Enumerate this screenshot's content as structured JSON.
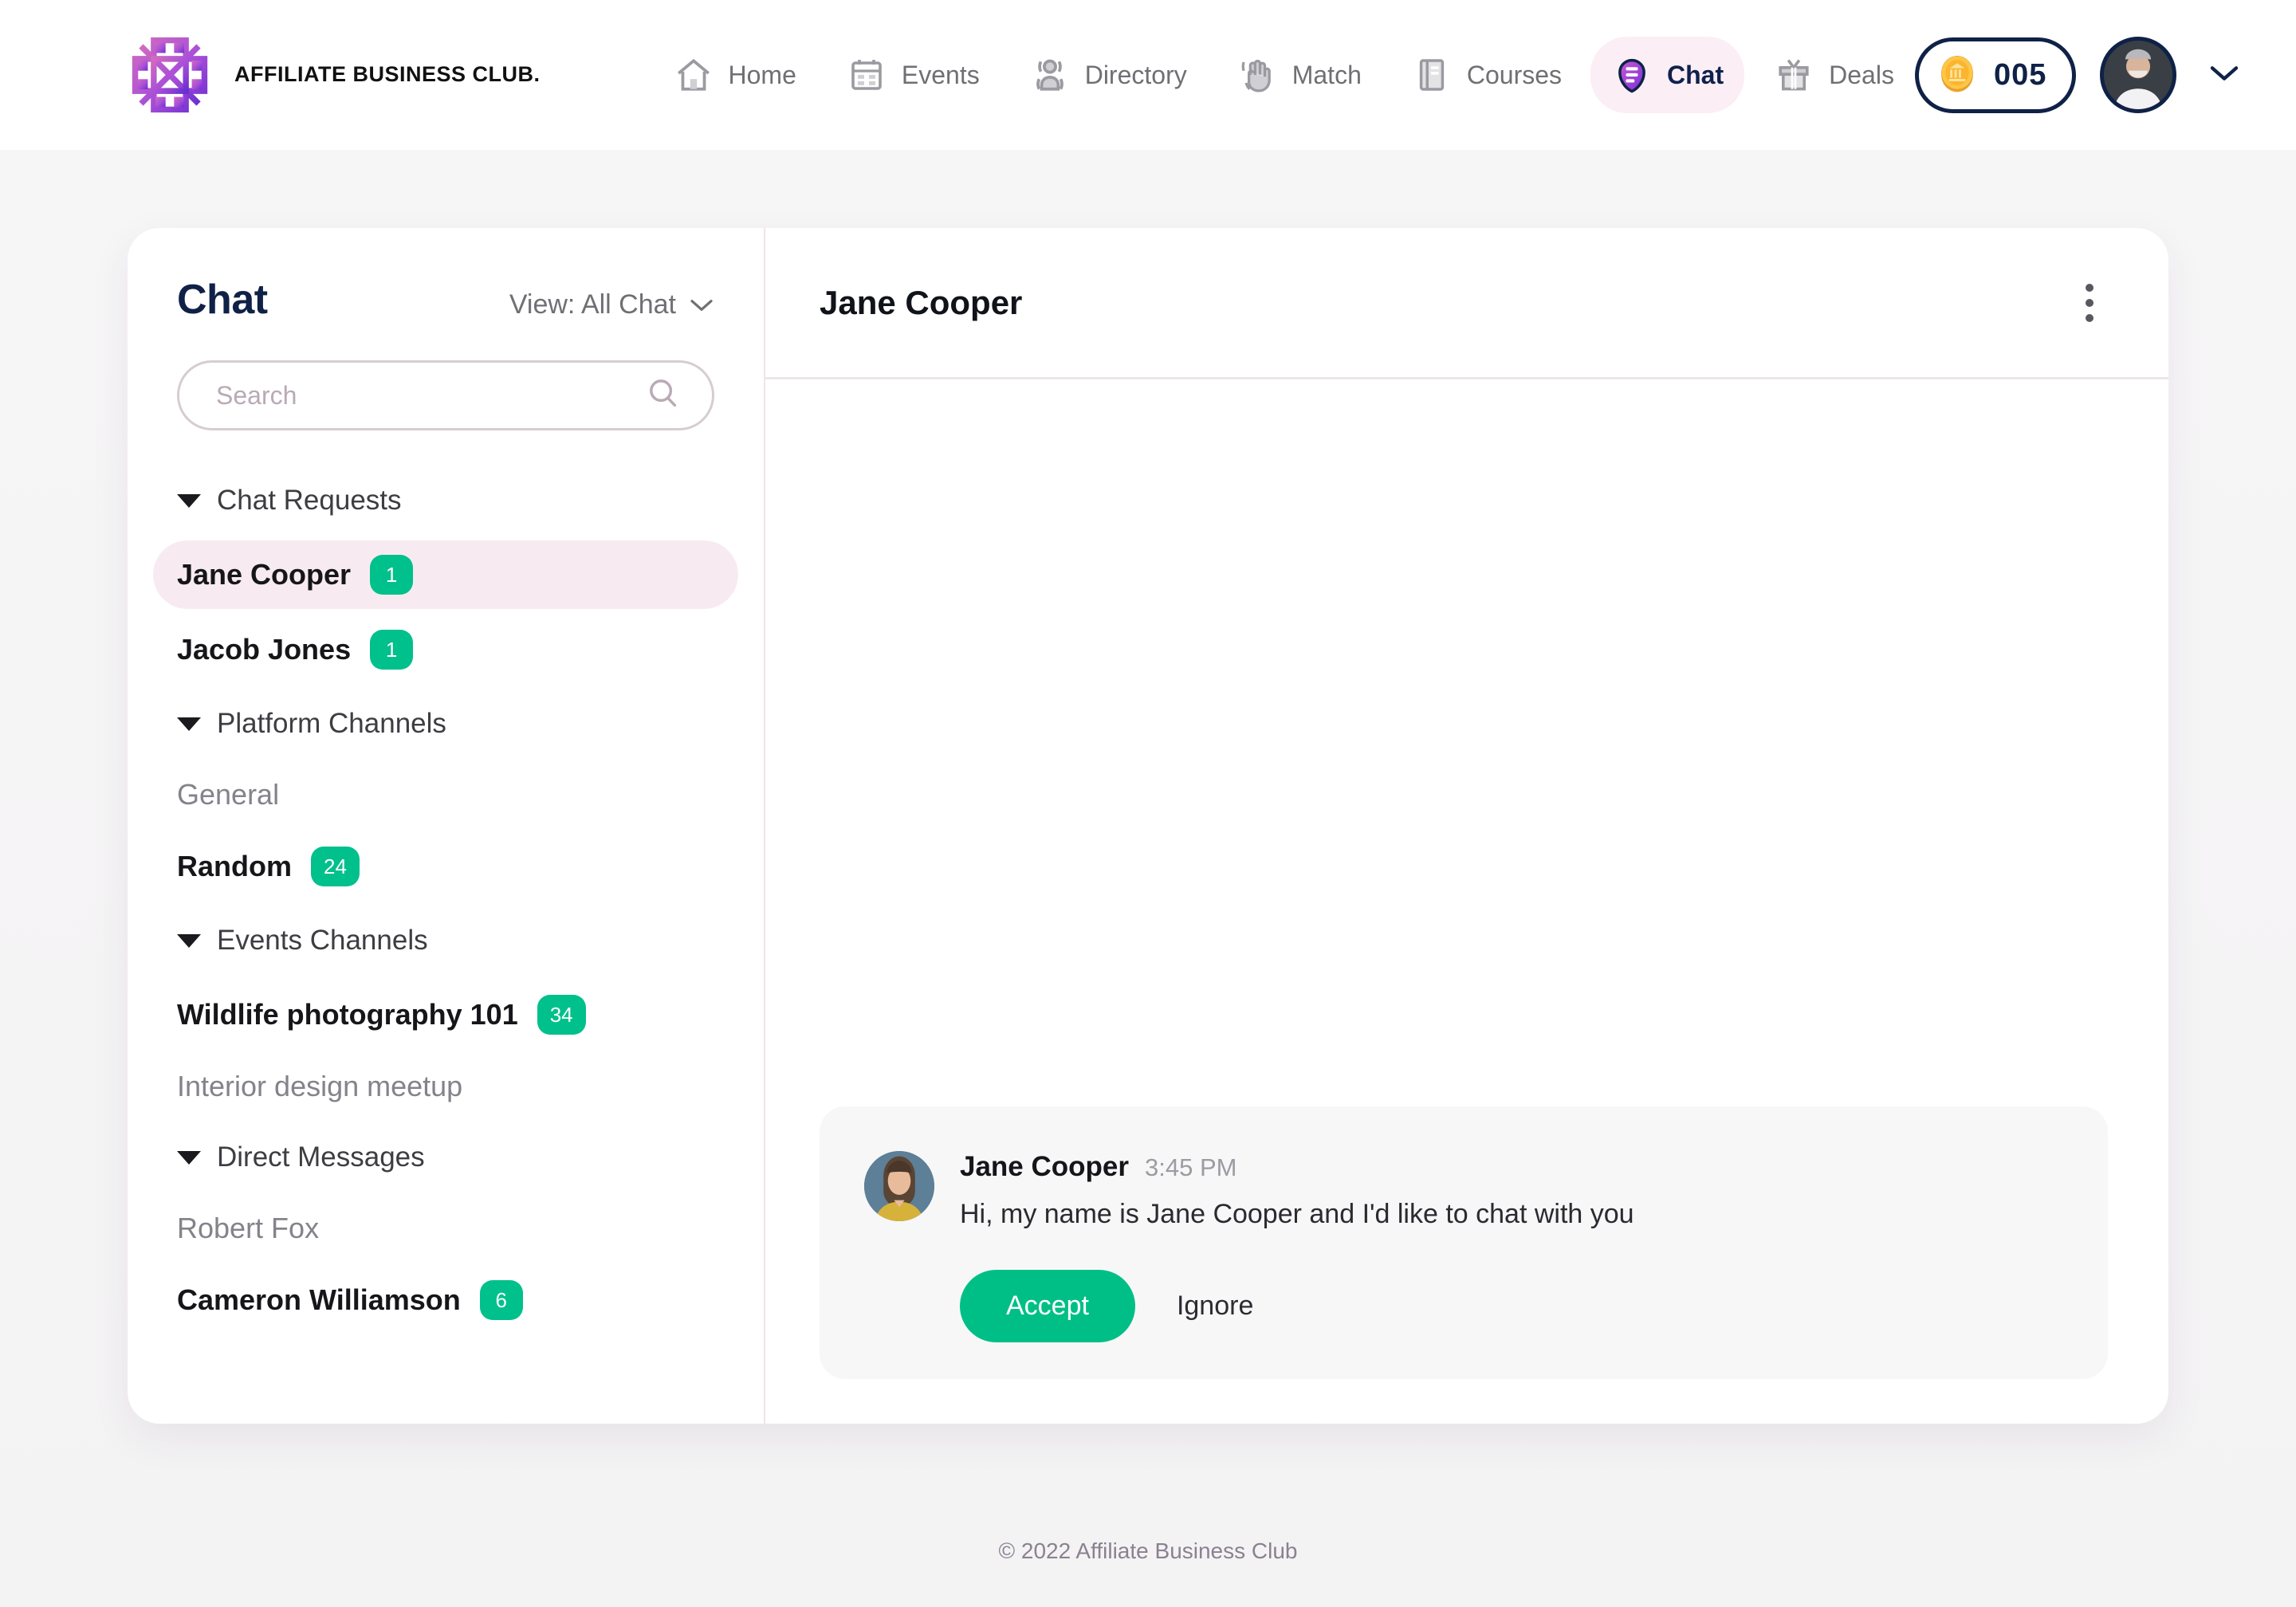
{
  "brand": {
    "name_lines": "AFFILIATE BUSINESS CLUB.",
    "logo_icon": "abc-monogram-icon"
  },
  "topnav": {
    "items": [
      {
        "label": "Home",
        "icon": "home-icon",
        "active": false
      },
      {
        "label": "Events",
        "icon": "calendar-icon",
        "active": false
      },
      {
        "label": "Directory",
        "icon": "people-icon",
        "active": false
      },
      {
        "label": "Match",
        "icon": "waving-hand-icon",
        "active": false
      },
      {
        "label": "Courses",
        "icon": "book-icon",
        "active": false
      },
      {
        "label": "Chat",
        "icon": "chat-bubble-icon",
        "active": true
      },
      {
        "label": "Deals",
        "icon": "gift-icon",
        "active": false
      }
    ],
    "coins": "005",
    "coin_icon": "coin-icon",
    "avatar_icon": "user-avatar",
    "chevron_icon": "chevron-down-icon"
  },
  "sidebar": {
    "title": "Chat",
    "view_label": "View: All Chat",
    "view_chevron_icon": "chevron-down-icon",
    "search": {
      "placeholder": "Search",
      "value": "",
      "icon": "search-icon"
    },
    "groups": [
      {
        "label": "Chat Requests",
        "caret_icon": "caret-down-icon",
        "items": [
          {
            "name": "Jane Cooper",
            "badge": "1",
            "unread": true,
            "selected": true
          },
          {
            "name": "Jacob Jones",
            "badge": "1",
            "unread": true,
            "selected": false
          }
        ]
      },
      {
        "label": "Platform Channels",
        "caret_icon": "caret-down-icon",
        "items": [
          {
            "name": "General",
            "badge": "",
            "unread": false,
            "selected": false
          },
          {
            "name": "Random",
            "badge": "24",
            "unread": true,
            "selected": false
          }
        ]
      },
      {
        "label": "Events Channels",
        "caret_icon": "caret-down-icon",
        "items": [
          {
            "name": "Wildlife photography 101",
            "badge": "34",
            "unread": true,
            "selected": false
          },
          {
            "name": "Interior design meetup",
            "badge": "",
            "unread": false,
            "selected": false
          }
        ]
      },
      {
        "label": "Direct Messages",
        "caret_icon": "caret-down-icon",
        "items": [
          {
            "name": "Robert Fox",
            "badge": "",
            "unread": false,
            "selected": false
          },
          {
            "name": "Cameron Williamson",
            "badge": "6",
            "unread": true,
            "selected": false
          }
        ]
      }
    ]
  },
  "conversation": {
    "title": "Jane Cooper",
    "menu_icon": "kebab-menu-icon",
    "message": {
      "avatar_icon": "jane-cooper-avatar",
      "sender": "Jane Cooper",
      "time": "3:45 PM",
      "text": "Hi, my name is Jane Cooper and I'd like to chat with you",
      "accept_label": "Accept",
      "ignore_label": "Ignore"
    }
  },
  "footer": {
    "copyright": "© 2022 Affiliate Business Club"
  },
  "colors": {
    "accent_purple": "#9b3fd4",
    "brand_navy": "#0f2147",
    "badge_green": "#00c08b",
    "selected_pink": "#f7ebf1",
    "page_bg": "#f7f6f7"
  }
}
